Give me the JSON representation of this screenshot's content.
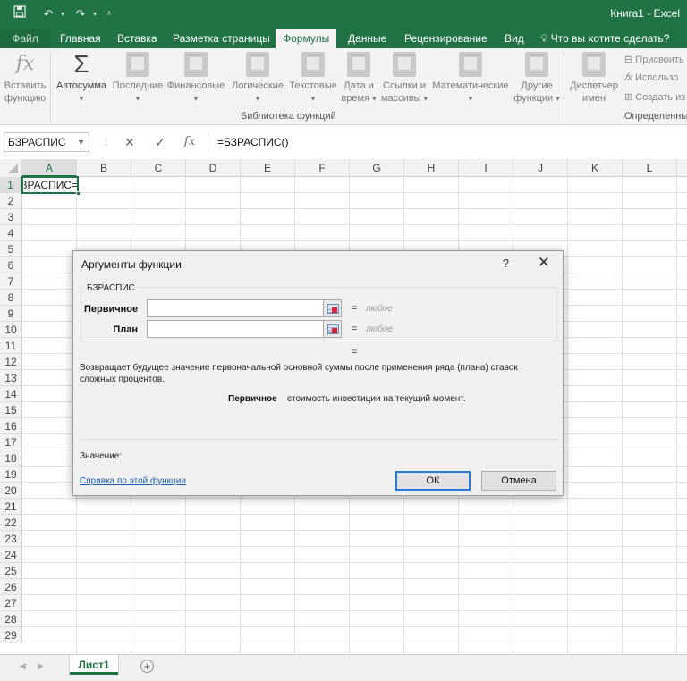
{
  "window": {
    "title": "Книга1 - Excel"
  },
  "qat": {
    "save_icon": "save-icon",
    "undo_icon": "undo-icon",
    "redo_icon": "redo-icon",
    "customize_icon": "customize-icon"
  },
  "tabs": {
    "file": "Файл",
    "items": [
      "Главная",
      "Вставка",
      "Разметка страницы",
      "Формулы",
      "Данные",
      "Рецензирование",
      "Вид"
    ],
    "active": "Формулы",
    "tell_me": "Что вы хотите сделать?"
  },
  "ribbon": {
    "insert_function": [
      "Вставить",
      "функцию"
    ],
    "autosum": "Автосумма",
    "recent": "Последние",
    "financial": "Финансовые",
    "logical": "Логические",
    "text": "Текстовые",
    "datetime": [
      "Дата и",
      "время"
    ],
    "lookup": [
      "Ссылки и",
      "массивы"
    ],
    "math": "Математические",
    "other": [
      "Другие",
      "функции"
    ],
    "name_manager": [
      "Диспетчер",
      "имен"
    ],
    "define_name": "Присвоить",
    "use_in_formula": "Использо",
    "create_from_selection": "Создать из",
    "group_library": "Библиотека функций",
    "group_defined_names": "Определенные"
  },
  "formula_bar": {
    "name_box": "БЗРАСПИС",
    "cancel": "✕",
    "enter": "✓",
    "fx": "fx",
    "formula": "=БЗРАСПИС()"
  },
  "grid": {
    "columns": [
      "A",
      "B",
      "C",
      "D",
      "E",
      "F",
      "G",
      "H",
      "I",
      "J",
      "K",
      "L"
    ],
    "rows": [
      "1",
      "2",
      "3",
      "4",
      "5",
      "6",
      "7",
      "8",
      "9",
      "10",
      "11",
      "12",
      "13",
      "14",
      "15",
      "16",
      "17",
      "18",
      "19",
      "20",
      "21",
      "22",
      "23",
      "24",
      "25",
      "26",
      "27",
      "28",
      "29"
    ],
    "active_cell_text": "=БЗРАСПИС()",
    "active_cell_visible": "\\СПИС()"
  },
  "sheets": {
    "active": "Лист1",
    "add_label": "+"
  },
  "dialog": {
    "title": "Аргументы функции",
    "help": "?",
    "close": "✕",
    "function_name": "БЗРАСПИС",
    "args": [
      {
        "label": "Первичное",
        "value": "",
        "eq": "=",
        "hint": "любое"
      },
      {
        "label": "План",
        "value": "",
        "eq": "=",
        "hint": "любое"
      }
    ],
    "result_eq": "=",
    "description": "Возвращает будущее значение первоначальной основной суммы после применения ряда (плана) ставок сложных процентов.",
    "arg_desc_name": "Первичное",
    "arg_desc_text": "стоимость инвестиции на текущий момент.",
    "value_label": "Значение:",
    "help_link": "Справка по этой функции",
    "ok": "ОК",
    "cancel": "Отмена"
  },
  "colors": {
    "accent": "#217346",
    "link": "#1a5fb4",
    "default_button_border": "#2b79d8"
  }
}
